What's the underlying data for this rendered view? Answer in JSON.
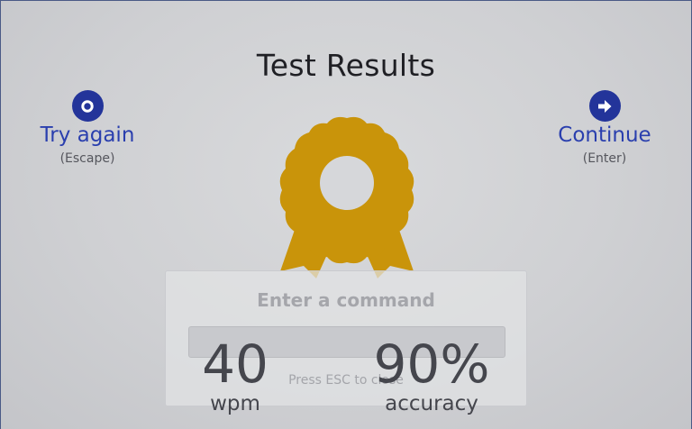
{
  "title": "Test Results",
  "actions": {
    "try_again": {
      "label": "Try again",
      "hint": "(Escape)",
      "icon": "redo-icon"
    },
    "continue": {
      "label": "Continue",
      "hint": "(Enter)",
      "icon": "arrow-right-icon"
    }
  },
  "badge": {
    "icon": "award-ribbon-icon",
    "color": "#c9940a"
  },
  "command_palette": {
    "title": "Enter a command",
    "input_value": "",
    "hint": "Press ESC to close"
  },
  "stats": {
    "wpm": {
      "value": "40",
      "unit": "wpm"
    },
    "accuracy": {
      "value": "90%",
      "unit": "accuracy"
    }
  },
  "colors": {
    "accent": "#2a3fae",
    "icon_bg": "#23349a",
    "badge": "#c9940a",
    "text": "#1f1f24"
  }
}
